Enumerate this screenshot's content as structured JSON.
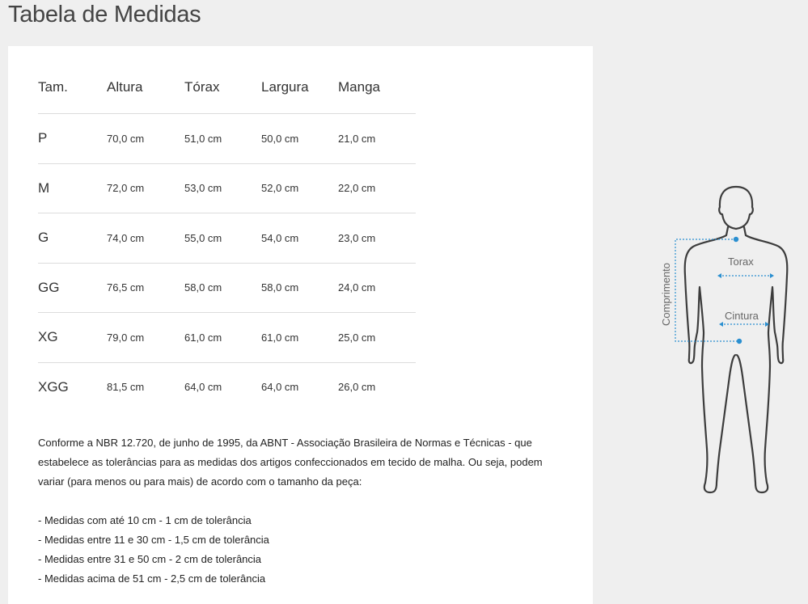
{
  "page": {
    "title": "Tabela de Medidas"
  },
  "table": {
    "headers": [
      "Tam.",
      "Altura",
      "Tórax",
      "Largura",
      "Manga"
    ],
    "rows": [
      [
        "P",
        "70,0 cm",
        "51,0 cm",
        "50,0 cm",
        "21,0 cm"
      ],
      [
        "M",
        "72,0 cm",
        "53,0 cm",
        "52,0 cm",
        "22,0 cm"
      ],
      [
        "G",
        "74,0 cm",
        "55,0 cm",
        "54,0 cm",
        "23,0 cm"
      ],
      [
        "GG",
        "76,5 cm",
        "58,0 cm",
        "58,0 cm",
        "24,0 cm"
      ],
      [
        "XG",
        "79,0 cm",
        "61,0 cm",
        "61,0 cm",
        "25,0 cm"
      ],
      [
        "XGG",
        "81,5 cm",
        "64,0 cm",
        "64,0 cm",
        "26,0 cm"
      ]
    ]
  },
  "note": {
    "text": "Conforme a NBR 12.720, de junho de 1995, da ABNT - Associação Brasileira de Normas e Técnicas - que estabelece as tolerâncias para as medidas dos artigos confeccionados em tecido de malha. Ou seja, podem variar (para menos ou para mais) de acordo com o tamanho da peça:"
  },
  "tolerances": [
    "- Medidas com até 10 cm - 1 cm de tolerância",
    "- Medidas entre 11 e 30 cm - 1,5 cm de tolerância",
    "- Medidas entre 31 e 50 cm - 2 cm de tolerância",
    "- Medidas acima de 51 cm - 2,5 cm de tolerância"
  ],
  "figure": {
    "label_length": "Comprimento",
    "label_chest": "Torax",
    "label_waist": "Cintura",
    "colors": {
      "outline": "#3c3c3c",
      "measure": "#2a8fd0"
    }
  }
}
